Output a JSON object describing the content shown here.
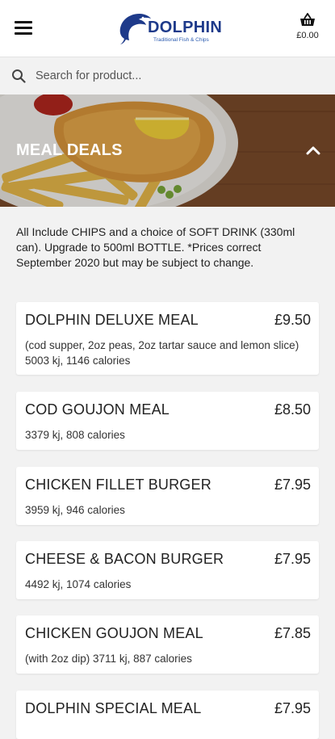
{
  "header": {
    "logo_title": "DOLPHIN",
    "logo_subtitle": "Traditional Fish & Chips",
    "cart_total": "£0.00",
    "menu_icon": "hamburger-menu-icon",
    "cart_icon": "basket-icon",
    "brand_color": "#1e3a8a"
  },
  "search": {
    "placeholder": "Search for product..."
  },
  "category": {
    "title": "MEAL DEALS",
    "intro": "All Include CHIPS and a choice of SOFT DRINK (330ml can). Upgrade to 500ml BOTTLE. *Prices correct September 2020 but may be subject to change."
  },
  "items": [
    {
      "name": "DOLPHIN DELUXE MEAL",
      "price": "£9.50",
      "desc": "(cod supper, 2oz peas, 2oz tartar sauce and lemon slice) 5003 kj, 1146 calories"
    },
    {
      "name": "COD GOUJON MEAL",
      "price": "£8.50",
      "desc": "3379 kj, 808 calories"
    },
    {
      "name": "CHICKEN FILLET BURGER",
      "price": "£7.95",
      "desc": "3959 kj, 946 calories"
    },
    {
      "name": "CHEESE & BACON BURGER",
      "price": "£7.95",
      "desc": "4492 kj, 1074 calories"
    },
    {
      "name": "CHICKEN GOUJON MEAL",
      "price": "£7.85",
      "desc": "(with 2oz dip) 3711 kj, 887 calories"
    },
    {
      "name": "DOLPHIN SPECIAL MEAL",
      "price": "£7.95",
      "desc": ""
    }
  ]
}
